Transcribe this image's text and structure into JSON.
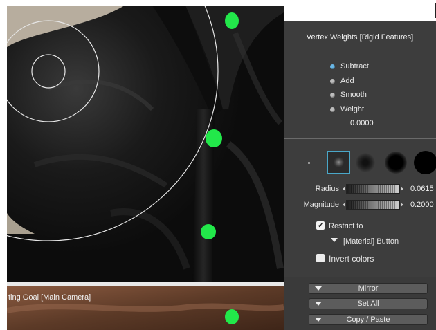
{
  "panel": {
    "title": "Vertex Weights [Rigid Features]",
    "modes": [
      {
        "label": "Subtract",
        "selected": true
      },
      {
        "label": "Add",
        "selected": false
      },
      {
        "label": "Smooth",
        "selected": false
      },
      {
        "label": "Weight",
        "selected": false
      }
    ],
    "weight_value": "0.0000",
    "brushes": [
      "brush-tiny",
      "brush-small-soft",
      "brush-medium-soft",
      "brush-large-soft",
      "brush-large-hard"
    ],
    "radius": {
      "label": "Radius",
      "value": "0.0615",
      "fraction": 0.5
    },
    "magnitude": {
      "label": "Magnitude",
      "value": "0.2000",
      "fraction": 0.5
    },
    "restrict_to": {
      "label": "Restrict to",
      "checked": true
    },
    "restrict_target": "[Material] Button",
    "invert_colors": {
      "label": "Invert colors",
      "checked": false
    },
    "buttons": {
      "mirror": "Mirror",
      "set_all": "Set All",
      "copy_paste": "Copy / Paste"
    }
  },
  "viewport_bottom": {
    "label": "ting Goal [Main Camera]"
  },
  "colors": {
    "panel_bg": "#3d3d3d",
    "marker": "#22e84a",
    "radio_selected": "#6ab7e6",
    "fabric": "#141414",
    "wall": "#b7ad9e",
    "skin": "#6a4430"
  }
}
